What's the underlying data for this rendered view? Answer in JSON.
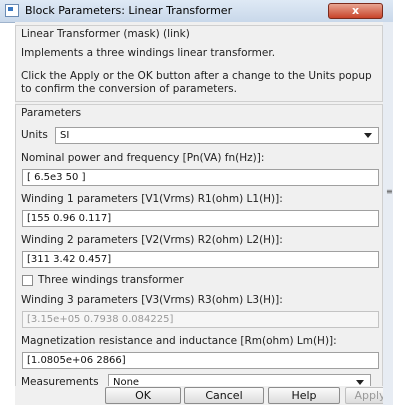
{
  "window": {
    "title": "Block Parameters: Linear Transformer",
    "close_label": "x"
  },
  "header": {
    "block_name": "Linear Transformer (mask) (link)",
    "description": "Implements a three windings linear transformer.",
    "note_line1": "Click the Apply or the OK button after a change to the Units popup",
    "note_line2": "to confirm the conversion of parameters."
  },
  "params": {
    "group_label": "Parameters",
    "units_label": "Units",
    "units_value": "SI",
    "nominal_label": "Nominal power and frequency [Pn(VA) fn(Hz)]:",
    "nominal_value": "[ 6.5e3 50 ]",
    "w1_label": "Winding 1 parameters [V1(Vrms) R1(ohm) L1(H)]:",
    "w1_value": "[155 0.96 0.117]",
    "w2_label": "Winding 2 parameters [V2(Vrms) R2(ohm) L2(H)]:",
    "w2_value": "[311 3.42 0.457]",
    "three_windings_label": "Three windings transformer",
    "three_windings_checked": false,
    "w3_label": "Winding 3 parameters [V3(Vrms) R3(ohm) L3(H)]:",
    "w3_value": "[3.15e+05 0.7938 0.084225]",
    "mag_label": "Magnetization resistance and inductance [Rm(ohm) Lm(H)]:",
    "mag_value": "[1.0805e+06 2866]",
    "measurements_label": "Measurements",
    "measurements_value": "None"
  },
  "buttons": {
    "ok": "OK",
    "cancel": "Cancel",
    "help": "Help",
    "apply": "Apply"
  }
}
